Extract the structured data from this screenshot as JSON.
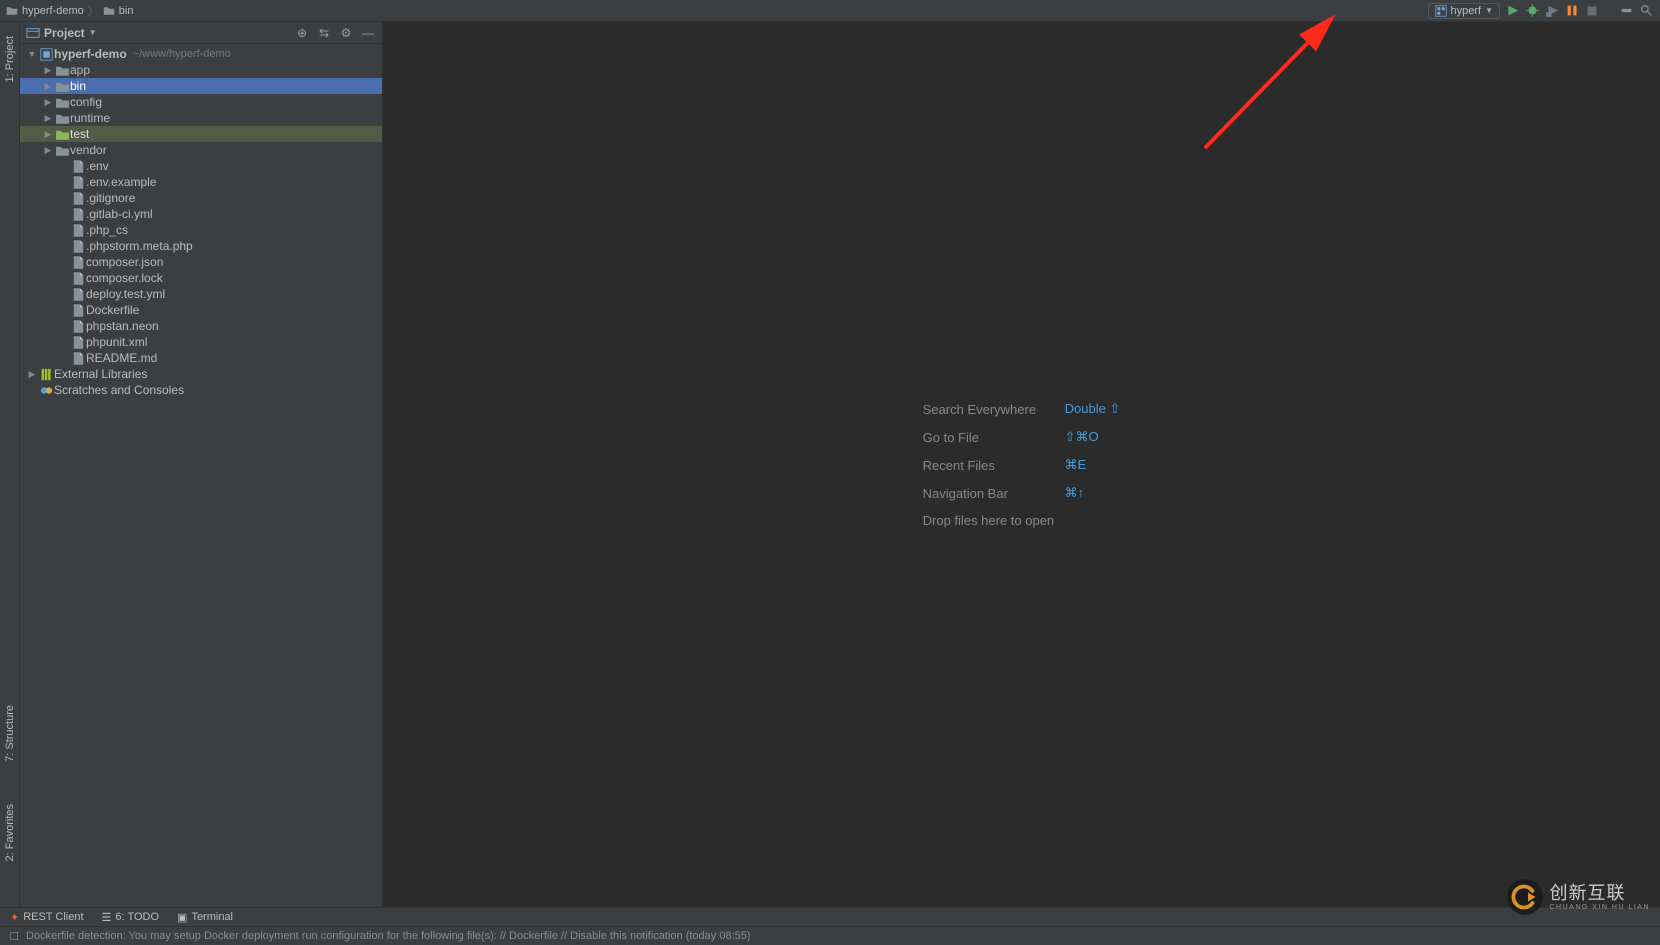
{
  "breadcrumb": {
    "root": "hyperf-demo",
    "child": "bin"
  },
  "run_config": {
    "label": "hyperf"
  },
  "panel": {
    "title": "Project"
  },
  "tree": {
    "root": {
      "name": "hyperf-demo",
      "path": "~/www/hyperf-demo"
    },
    "folders": [
      {
        "name": "app",
        "kind": "folder",
        "expanded": false,
        "selected": false
      },
      {
        "name": "bin",
        "kind": "folder",
        "expanded": false,
        "selected": true
      },
      {
        "name": "config",
        "kind": "folder",
        "expanded": false,
        "selected": false
      },
      {
        "name": "runtime",
        "kind": "folder",
        "expanded": false,
        "selected": false
      },
      {
        "name": "test",
        "kind": "test-folder",
        "expanded": false,
        "selected": false,
        "highlight": true
      },
      {
        "name": "vendor",
        "kind": "folder",
        "expanded": false,
        "selected": false
      }
    ],
    "files": [
      ".env",
      ".env.example",
      ".gitignore",
      ".gitlab-ci.yml",
      ".php_cs",
      ".phpstorm.meta.php",
      "composer.json",
      "composer.lock",
      "deploy.test.yml",
      "Dockerfile",
      "phpstan.neon",
      "phpunit.xml",
      "README.md"
    ],
    "external": "External Libraries",
    "scratches": "Scratches and Consoles"
  },
  "hints": {
    "search": {
      "label": "Search Everywhere",
      "key": "Double ⇧"
    },
    "goto": {
      "label": "Go to File",
      "key": "⇧⌘O"
    },
    "recent": {
      "label": "Recent Files",
      "key": "⌘E"
    },
    "nav": {
      "label": "Navigation Bar",
      "key": "⌘↑"
    },
    "drop": {
      "text": "Drop files here to open"
    }
  },
  "bottom_tabs": {
    "rest": "REST Client",
    "todo": "6: TODO",
    "terminal": "Terminal"
  },
  "left_gutter": {
    "project": "1: Project",
    "structure": "7: Structure",
    "favorites": "2: Favorites"
  },
  "status": {
    "message": "Dockerfile detection: You may setup Docker deployment run configuration for the following file(s): // Dockerfile // Disable this notification (today 08:55)"
  },
  "watermark": {
    "text1": "创新互联",
    "text2": "CHUANG XIN HU LIAN"
  }
}
